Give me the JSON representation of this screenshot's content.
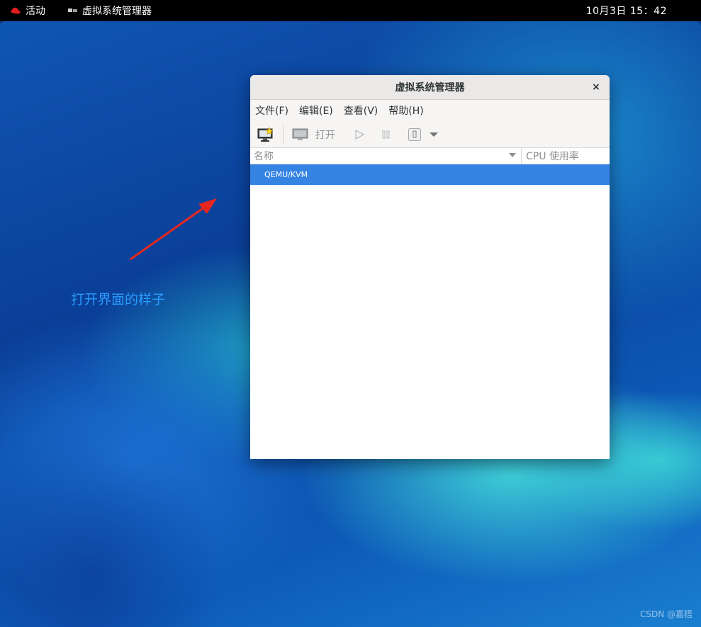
{
  "topbar": {
    "activities_label": "活动",
    "app_name": "虚拟系统管理器",
    "clock": "10月3日 15：42"
  },
  "annotation": {
    "text": "打开界面的样子"
  },
  "watermark": "CSDN @嘉梧",
  "window": {
    "title": "虚拟系统管理器",
    "close_glyph": "×",
    "menu": [
      "文件(F)",
      "编辑(E)",
      "查看(V)",
      "帮助(H)"
    ],
    "toolbar": {
      "open_label": "打开"
    },
    "columns": {
      "name": "名称",
      "cpu": "CPU 使用率"
    },
    "connections": [
      {
        "name": "QEMU/KVM",
        "selected": true
      }
    ]
  },
  "colors": {
    "selection": "#3584e4",
    "annotation": "#2b9cff",
    "arrow": "#e8261f"
  }
}
